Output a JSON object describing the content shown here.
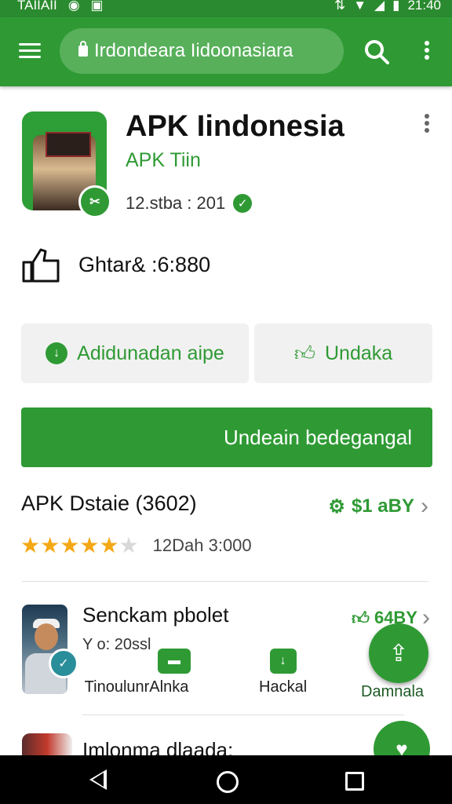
{
  "status_bar": {
    "carrier": "TAIIAII",
    "time": "21:40"
  },
  "toolbar": {
    "url_text": "Irdondeara Iidoonasiara"
  },
  "app": {
    "title": "APK Iindonesia",
    "developer": "APK Tiin",
    "version": "12.stba : 201",
    "stat_text": "Ghtar& :6:880"
  },
  "buttons": {
    "secondary_left": "Adidunadan aipe",
    "secondary_right": "Undaka",
    "primary": "Undeain bedegangal"
  },
  "details": {
    "title": "APK Dstaie (3602)",
    "price": "$1 aBY",
    "rating": 4.5,
    "rating_max": 5,
    "rating_text": "12Dah 3:000"
  },
  "list_items": [
    {
      "title": "Senckam pbolet",
      "subtitle": "Y o: 20ssl",
      "price": "64BY",
      "actions": [
        {
          "label": "TinoulunrAlnka"
        },
        {
          "label": "Hackal"
        },
        {
          "label": "Damnala"
        }
      ]
    },
    {
      "title": "Imlonma dlaada:"
    }
  ],
  "colors": {
    "brand_green": "#2f9a34",
    "star": "#f4a815"
  }
}
